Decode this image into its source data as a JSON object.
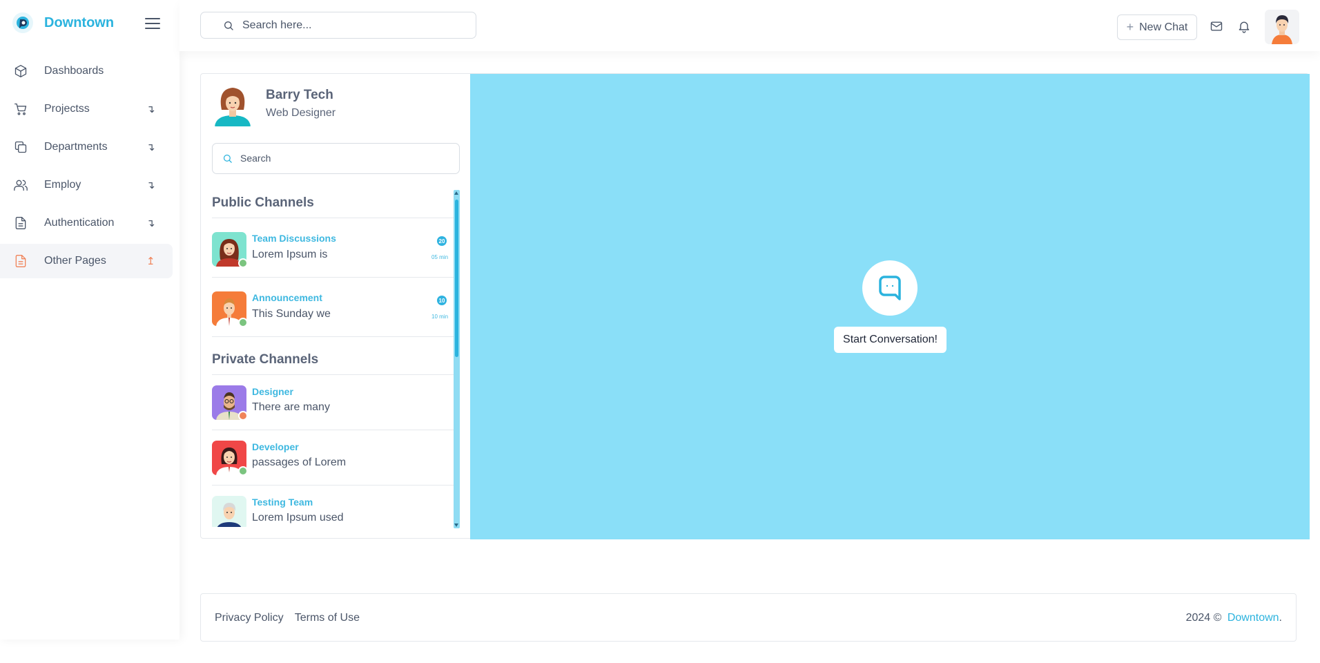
{
  "brand": {
    "name": "Downtown"
  },
  "sidebar": {
    "items": [
      {
        "label": "Dashboards",
        "icon": "cube-icon",
        "arrow": ""
      },
      {
        "label": "Projectss",
        "icon": "cart-icon",
        "arrow": "↴"
      },
      {
        "label": "Departments",
        "icon": "copy-icon",
        "arrow": "↴"
      },
      {
        "label": "Employ",
        "icon": "users-icon",
        "arrow": "↴"
      },
      {
        "label": "Authentication",
        "icon": "file-icon",
        "arrow": "↴"
      },
      {
        "label": "Other Pages",
        "icon": "file-icon",
        "arrow": "↥"
      }
    ]
  },
  "topbar": {
    "search_placeholder": "Search here...",
    "new_chat_label": "New Chat"
  },
  "profile": {
    "name": "Barry Tech",
    "role": "Web Designer"
  },
  "chat_search": {
    "placeholder": "Search"
  },
  "public_channels": {
    "title": "Public Channels",
    "items": [
      {
        "name": "Team Discussions",
        "message": "Lorem Ipsum is",
        "badge": "20",
        "time": "05 min",
        "status_color": "#7bc47f"
      },
      {
        "name": "Announcement",
        "message": "This Sunday we",
        "badge": "10",
        "time": "10 min",
        "status_color": "#7bc47f"
      }
    ]
  },
  "private_channels": {
    "title": "Private Channels",
    "items": [
      {
        "name": "Designer",
        "message": "There are many",
        "status_color": "#f0845a"
      },
      {
        "name": "Developer",
        "message": "passages of Lorem",
        "status_color": "#7bc47f"
      },
      {
        "name": "Testing Team",
        "message": "Lorem Ipsum used",
        "status_color": "#7bc47f"
      }
    ]
  },
  "chat_panel": {
    "start_label": "Start Conversation!"
  },
  "footer": {
    "links": [
      "Privacy Policy",
      "Terms of Use"
    ],
    "copyright": "2024 ©",
    "brand": "Downtown",
    "period": "."
  },
  "colors": {
    "accent": "#2bb3de",
    "chat_bg": "#8adff8",
    "orange": "#f0845a"
  }
}
